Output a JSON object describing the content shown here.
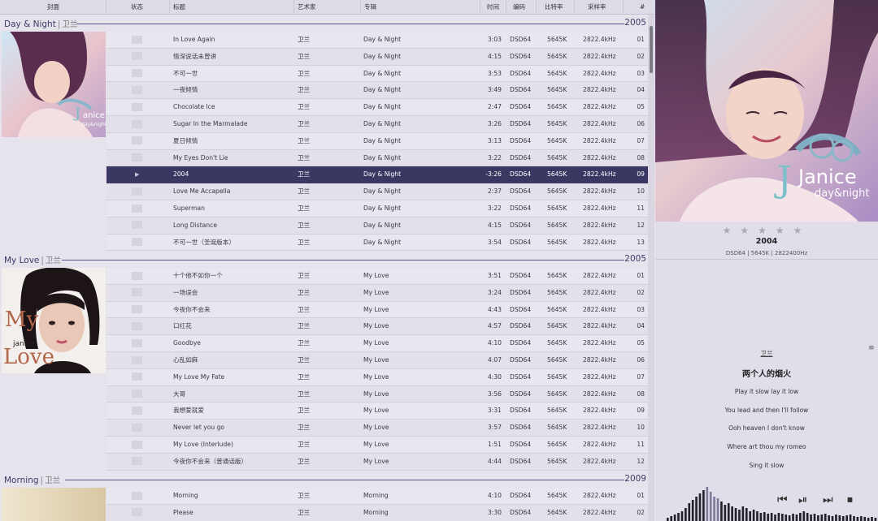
{
  "columns": {
    "cover": "封面",
    "status": "状态",
    "title": "标题",
    "artist": "艺术家",
    "album": "专辑",
    "time": "时间",
    "codec": "编码",
    "bitrate": "比特率",
    "samplerate": "采样率",
    "num": "#"
  },
  "groups": [
    {
      "album": "Day & Night",
      "sep": "|",
      "artist": "卫兰",
      "year": "2005",
      "cover_text": "Janice day&night",
      "tracks": [
        {
          "title": "In Love Again",
          "artist": "卫兰",
          "album": "Day & Night",
          "time": "3:03",
          "codec": "DSD64",
          "bitrate": "5645K",
          "rate": "2822.4kHz",
          "num": "01"
        },
        {
          "title": "情深说话未曾讲",
          "artist": "卫兰",
          "album": "Day & Night",
          "time": "4:15",
          "codec": "DSD64",
          "bitrate": "5645K",
          "rate": "2822.4kHz",
          "num": "02"
        },
        {
          "title": "不可一世",
          "artist": "卫兰",
          "album": "Day & Night",
          "time": "3:53",
          "codec": "DSD64",
          "bitrate": "5645K",
          "rate": "2822.4kHz",
          "num": "03"
        },
        {
          "title": "一夜倾情",
          "artist": "卫兰",
          "album": "Day & Night",
          "time": "3:49",
          "codec": "DSD64",
          "bitrate": "5645K",
          "rate": "2822.4kHz",
          "num": "04"
        },
        {
          "title": "Chocolate Ice",
          "artist": "卫兰",
          "album": "Day & Night",
          "time": "2:47",
          "codec": "DSD64",
          "bitrate": "5645K",
          "rate": "2822.4kHz",
          "num": "05"
        },
        {
          "title": "Sugar In the Marmalade",
          "artist": "卫兰",
          "album": "Day & Night",
          "time": "3:26",
          "codec": "DSD64",
          "bitrate": "5645K",
          "rate": "2822.4kHz",
          "num": "06"
        },
        {
          "title": "夏日倾情",
          "artist": "卫兰",
          "album": "Day & Night",
          "time": "3:13",
          "codec": "DSD64",
          "bitrate": "5645K",
          "rate": "2822.4kHz",
          "num": "07"
        },
        {
          "title": "My Eyes Don't Lie",
          "artist": "卫兰",
          "album": "Day & Night",
          "time": "3:22",
          "codec": "DSD64",
          "bitrate": "5645K",
          "rate": "2822.4kHz",
          "num": "08"
        },
        {
          "title": "2004",
          "artist": "卫兰",
          "album": "Day & Night",
          "time": "-3:26",
          "codec": "DSD64",
          "bitrate": "5645K",
          "rate": "2822.4kHz",
          "num": "09",
          "playing": true
        },
        {
          "title": "Love Me Accapella",
          "artist": "卫兰",
          "album": "Day & Night",
          "time": "2:37",
          "codec": "DSD64",
          "bitrate": "5645K",
          "rate": "2822.4kHz",
          "num": "10"
        },
        {
          "title": "Superman",
          "artist": "卫兰",
          "album": "Day & Night",
          "time": "3:22",
          "codec": "DSD64",
          "bitrate": "5645K",
          "rate": "2822.4kHz",
          "num": "11"
        },
        {
          "title": "Long Distance",
          "artist": "卫兰",
          "album": "Day & Night",
          "time": "4:15",
          "codec": "DSD64",
          "bitrate": "5645K",
          "rate": "2822.4kHz",
          "num": "12"
        },
        {
          "title": "不可一世（圣诞版本）",
          "artist": "卫兰",
          "album": "Day & Night",
          "time": "3:54",
          "codec": "DSD64",
          "bitrate": "5645K",
          "rate": "2822.4kHz",
          "num": "13"
        }
      ]
    },
    {
      "album": "My Love",
      "sep": "|",
      "artist": "卫兰",
      "year": "2005",
      "cover_text": "My Love janice",
      "tracks": [
        {
          "title": "十个他不如你一个",
          "artist": "卫兰",
          "album": "My Love",
          "time": "3:51",
          "codec": "DSD64",
          "bitrate": "5645K",
          "rate": "2822.4kHz",
          "num": "01"
        },
        {
          "title": "一场误会",
          "artist": "卫兰",
          "album": "My Love",
          "time": "3:24",
          "codec": "DSD64",
          "bitrate": "5645K",
          "rate": "2822.4kHz",
          "num": "02"
        },
        {
          "title": "今夜你不会来",
          "artist": "卫兰",
          "album": "My Love",
          "time": "4:43",
          "codec": "DSD64",
          "bitrate": "5645K",
          "rate": "2822.4kHz",
          "num": "03"
        },
        {
          "title": "口红花",
          "artist": "卫兰",
          "album": "My Love",
          "time": "4:57",
          "codec": "DSD64",
          "bitrate": "5645K",
          "rate": "2822.4kHz",
          "num": "04"
        },
        {
          "title": "Goodbye",
          "artist": "卫兰",
          "album": "My Love",
          "time": "4:10",
          "codec": "DSD64",
          "bitrate": "5645K",
          "rate": "2822.4kHz",
          "num": "05"
        },
        {
          "title": "心乱如麻",
          "artist": "卫兰",
          "album": "My Love",
          "time": "4:07",
          "codec": "DSD64",
          "bitrate": "5645K",
          "rate": "2822.4kHz",
          "num": "06"
        },
        {
          "title": "My Love My Fate",
          "artist": "卫兰",
          "album": "My Love",
          "time": "4:30",
          "codec": "DSD64",
          "bitrate": "5645K",
          "rate": "2822.4kHz",
          "num": "07"
        },
        {
          "title": "大哥",
          "artist": "卫兰",
          "album": "My Love",
          "time": "3:56",
          "codec": "DSD64",
          "bitrate": "5645K",
          "rate": "2822.4kHz",
          "num": "08"
        },
        {
          "title": "我想爱就爱",
          "artist": "卫兰",
          "album": "My Love",
          "time": "3:31",
          "codec": "DSD64",
          "bitrate": "5645K",
          "rate": "2822.4kHz",
          "num": "09"
        },
        {
          "title": "Never let you go",
          "artist": "卫兰",
          "album": "My Love",
          "time": "3:57",
          "codec": "DSD64",
          "bitrate": "5645K",
          "rate": "2822.4kHz",
          "num": "10"
        },
        {
          "title": "My Love (Interlude)",
          "artist": "卫兰",
          "album": "My Love",
          "time": "1:51",
          "codec": "DSD64",
          "bitrate": "5645K",
          "rate": "2822.4kHz",
          "num": "11"
        },
        {
          "title": "今夜你不会来（普通话版）",
          "artist": "卫兰",
          "album": "My Love",
          "time": "4:44",
          "codec": "DSD64",
          "bitrate": "5645K",
          "rate": "2822.4kHz",
          "num": "12"
        }
      ]
    },
    {
      "album": "Morning",
      "sep": "|",
      "artist": "卫兰",
      "year": "2009",
      "tracks": [
        {
          "title": "Morning",
          "artist": "卫兰",
          "album": "Morning",
          "time": "4:10",
          "codec": "DSD64",
          "bitrate": "5645K",
          "rate": "2822.4kHz",
          "num": "01"
        },
        {
          "title": "Please",
          "artist": "卫兰",
          "album": "Morning",
          "time": "3:30",
          "codec": "DSD64",
          "bitrate": "5645K",
          "rate": "2822.4kHz",
          "num": "02"
        }
      ]
    }
  ],
  "now_playing": {
    "cover_text_1": "Janice",
    "cover_text_2": "day&night",
    "rating_stars": "★★★★★",
    "rating_value": 0,
    "title": "2004",
    "format": "DSD64 | 5645K | 2822400Hz"
  },
  "lyrics": {
    "artist": "卫兰",
    "song": "两个人的烟火",
    "lines": [
      "Play it slow lay it low",
      "You lead and then I'll follow",
      "Ooh heaven I don't know",
      "Where art thou my romeo",
      "Sing it slow"
    ]
  },
  "icons": {
    "play_indicator": "play-triangle-icon",
    "side_tool": "hamburger-icon",
    "transport": [
      "previous-icon",
      "play-pause-icon",
      "next-icon",
      "stop-icon"
    ]
  },
  "colors": {
    "accent": "#3a3763",
    "group_line": "#5a5784",
    "list_bg": "#e6e3ed"
  },
  "spectrum": [
    4,
    6,
    8,
    10,
    12,
    16,
    22,
    26,
    30,
    34,
    38,
    42,
    36,
    30,
    28,
    24,
    20,
    22,
    18,
    16,
    14,
    18,
    16,
    12,
    14,
    12,
    10,
    11,
    9,
    10,
    8,
    10,
    9,
    8,
    7,
    9,
    8,
    10,
    12,
    10,
    8,
    9,
    7,
    8,
    9,
    7,
    6,
    8,
    7,
    6,
    7,
    8,
    6,
    5,
    6,
    5,
    4,
    5,
    4
  ]
}
